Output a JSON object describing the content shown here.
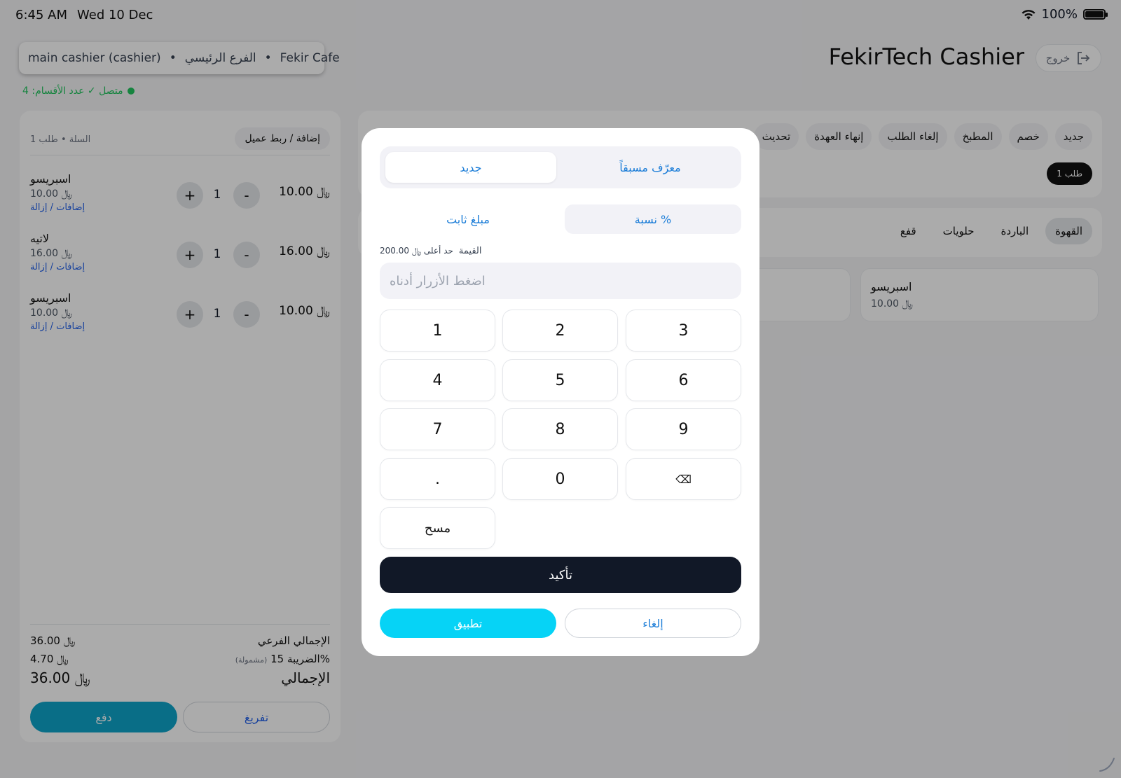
{
  "statusbar": {
    "time": "6:45 AM",
    "date": "Wed 10 Dec",
    "battery": "100%"
  },
  "header": {
    "session": {
      "user": "main cashier (cashier)",
      "branch": "الفرع الرئيسي",
      "store": "Fekir Cafe",
      "separator": "•"
    },
    "connection": "متصل ✓ عدد الأقسام: 4",
    "title": "FekirTech Cashier",
    "exit_label": "خروج"
  },
  "cart": {
    "count_label": "السلة • طلب 1",
    "add_customer_label": "إضافة / ربط عميل",
    "items": [
      {
        "name": "اسبريسو",
        "unit_price": "10.00 ﷼",
        "modifiers": "إضافات / إزالة",
        "qty": "1",
        "total": "10.00 ﷼"
      },
      {
        "name": "لاتيه",
        "unit_price": "16.00 ﷼",
        "modifiers": "إضافات / إزالة",
        "qty": "1",
        "total": "16.00 ﷼"
      },
      {
        "name": "اسبريسو",
        "unit_price": "10.00 ﷼",
        "modifiers": "إضافات / إزالة",
        "qty": "1",
        "total": "10.00 ﷼"
      }
    ],
    "plus": "+",
    "minus": "-",
    "subtotal_label": "الإجمالي الفرعي",
    "subtotal_value": "36.00 ﷼",
    "tax_label": "الضريبة 15%",
    "tax_note": "(مشمولة)",
    "tax_value": "4.70 ﷼",
    "total_label": "الإجمالي",
    "total_value": "36.00 ﷼",
    "pay_label": "دفع",
    "clear_label": "تفريغ"
  },
  "actions": {
    "chips": [
      "جديد",
      "خصم",
      "المطبخ",
      "إلغاء الطلب",
      "إنهاء العهدة",
      "تحديث"
    ],
    "order_tab": "طلب 1"
  },
  "categories": {
    "chips": [
      "القهوة",
      "الباردة",
      "حلويات",
      "قفع"
    ],
    "active": "القهوة"
  },
  "products": [
    {
      "name": "اسبريسو",
      "price": "10.00 ﷼"
    },
    {
      "name": "",
      "price": ""
    }
  ],
  "modal": {
    "source_tabs": {
      "predefined": "معرّف مسبقاً",
      "new": "جديد",
      "selected": "new"
    },
    "type_tabs": {
      "percent": "نسبة %",
      "fixed": "مبلغ ثابت",
      "selected": "percent"
    },
    "value_label": "القيمة",
    "max_label": "حد أعلى ﷼ 200.00",
    "input_placeholder": "اضغط الأزرار أدناه",
    "keys": [
      "1",
      "2",
      "3",
      "4",
      "5",
      "6",
      "7",
      "8",
      "9",
      ".",
      "0",
      "⌫"
    ],
    "clear_key": "مسح",
    "confirm_label": "تأكيد",
    "apply_label": "تطبيق",
    "cancel_label": "إلغاء"
  },
  "colors": {
    "accent": "#06d3f6",
    "pay": "#0ea5c9",
    "link": "#1d7ed8",
    "dark": "#111827",
    "online": "#22c55e"
  }
}
